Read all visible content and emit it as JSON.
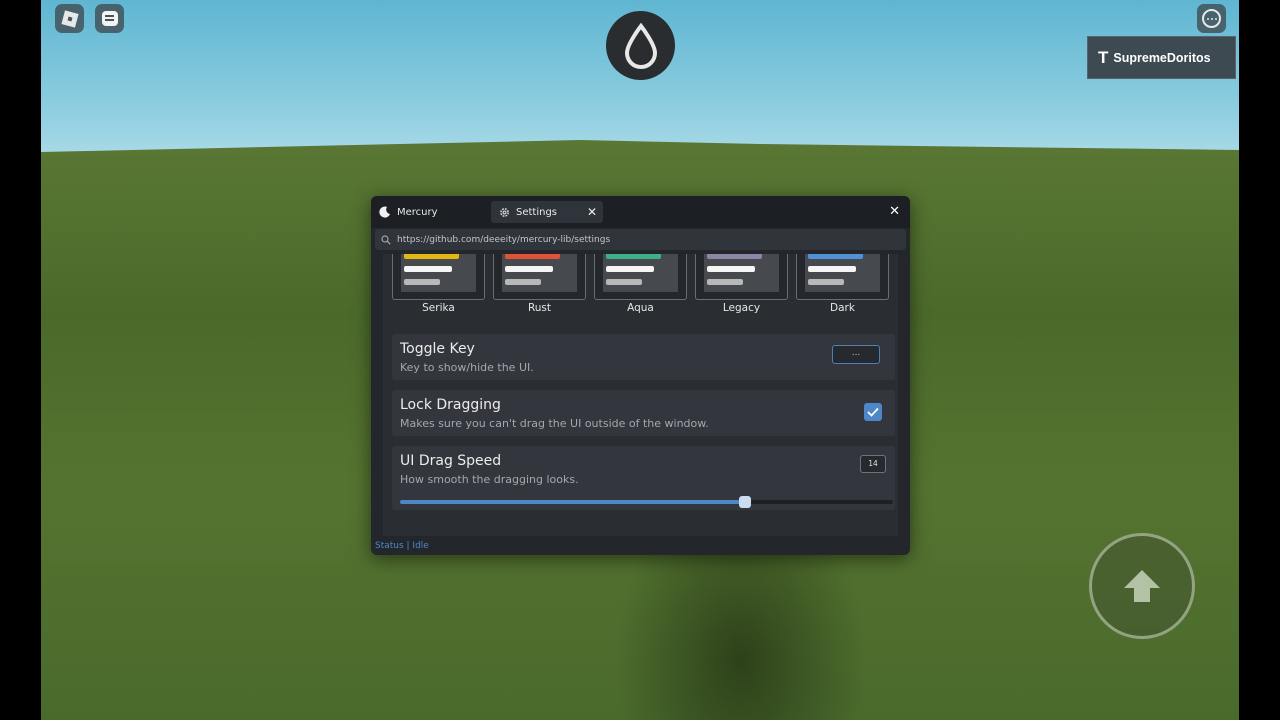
{
  "hud": {
    "username": "SupremeDoritos",
    "icons": {
      "roblox_menu": "roblox-logo-icon",
      "chat": "chat-icon",
      "center": "water-drop-icon",
      "more": "more-options-icon",
      "jump": "jump-arrow-icon"
    }
  },
  "window": {
    "tabs": [
      {
        "label": "Mercury",
        "icon": "moon-icon"
      },
      {
        "label": "Settings",
        "icon": "gear-icon",
        "closable": true
      }
    ],
    "tab_close_glyph": "✕",
    "close_glyph": "✕",
    "url": "https://github.com/deeeity/mercury-lib/settings",
    "themes": [
      {
        "name": "Serika",
        "accent": "#e2b714"
      },
      {
        "name": "Rust",
        "accent": "#e0533b"
      },
      {
        "name": "Aqua",
        "accent": "#3fae8a"
      },
      {
        "name": "Legacy",
        "accent": "#8b85a6"
      },
      {
        "name": "Dark",
        "accent": "#4f93d6"
      }
    ],
    "settings": {
      "toggle_key": {
        "title": "Toggle Key",
        "description": "Key to show/hide the UI.",
        "value": "..."
      },
      "lock_dragging": {
        "title": "Lock Dragging",
        "description": "Makes sure you can't drag the UI outside of the window.",
        "checked": true
      },
      "drag_speed": {
        "title": "UI Drag Speed",
        "description": "How smooth the dragging looks.",
        "value": "14",
        "fraction": 0.7
      }
    },
    "status": "Status | Idle",
    "colors": {
      "accent": "#4d87c7",
      "window_bg": "#23272c",
      "row_bg": "#33373d"
    }
  }
}
